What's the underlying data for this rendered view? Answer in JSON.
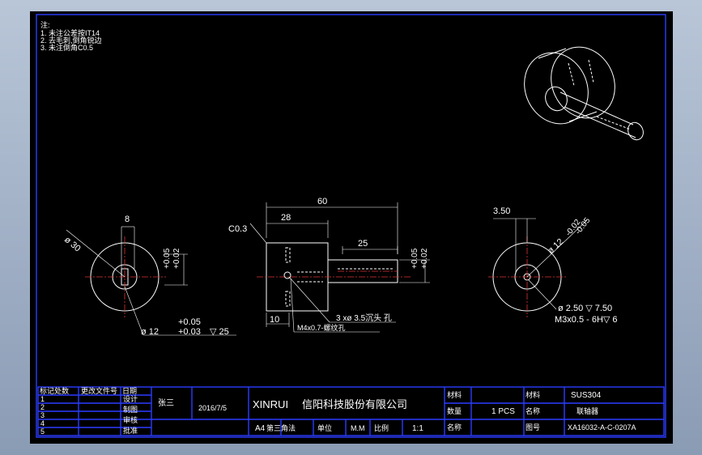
{
  "notes": {
    "title": "注:",
    "lines": [
      "1. 未注公差按IT14",
      "2. 去毛刺,倒角锐边",
      "3. 未注倒角C0.5"
    ]
  },
  "front_view": {
    "dia_outer": "ø 30",
    "width_key": "8",
    "tol_upper": "+0.05",
    "tol_lower": "+0.02",
    "bore_tol_upper": "+0.05",
    "bore_tol_lower": "+0.03",
    "bore_label": "ø 12",
    "bore_depth": "▽ 25"
  },
  "side_view": {
    "chamfer": "C0.3",
    "len_total": "60",
    "len_body": "28",
    "len_shaft": "25",
    "len_small": "10",
    "tol_upper": "+0.05",
    "tol_lower": "+0.02",
    "holes_label": "3 xø 3.5沉头 孔",
    "thread_label": "M4x0.7-螺纹孔"
  },
  "right_view": {
    "offset": "3.50",
    "dia_label": "ø 12",
    "tol_upper": "-0.02",
    "tol_lower": "-0.05",
    "hole_label": "ø 2.50 ▽ 7.50",
    "thread_label": "M3x0.5 - 6H▽ 6"
  },
  "title_block": {
    "company_en": "XINRUI",
    "company_cn": "信阳科技股份有限公司",
    "material_label": "材料",
    "material_value": "SUS304",
    "qty_label": "数量",
    "qty_value": "1  PCS",
    "name_label": "名称",
    "name_value": "联轴器",
    "part_label": "图号",
    "part_no": "XA16032-A-C-0207A",
    "size": "A4",
    "angle": "第三角法",
    "unit_label": "单位",
    "unit_value": "M.M",
    "scale_label": "比例",
    "scale_value": "1:1",
    "date": "2016/7/5",
    "designer_label": "设计",
    "designer": "张三",
    "drawer_label": "制图",
    "checker_label": "审核",
    "approver_label": "批准",
    "rev_headers": [
      "标记",
      "处数",
      "更改文件号",
      "日期"
    ],
    "rev_rows": [
      [
        "1",
        "",
        "",
        ""
      ],
      [
        "2",
        "",
        "",
        ""
      ],
      [
        "3",
        "",
        "",
        ""
      ],
      [
        "4",
        "",
        "",
        ""
      ],
      [
        "5",
        "",
        "",
        ""
      ]
    ]
  }
}
